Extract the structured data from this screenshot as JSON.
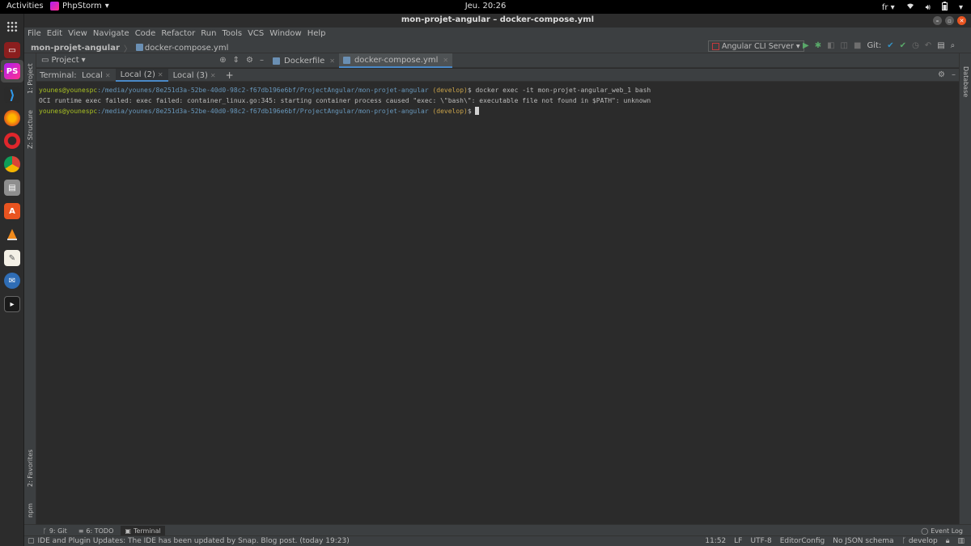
{
  "topbar": {
    "activities": "Activities",
    "app_name": "PhpStorm",
    "clock": "Jeu. 20:26",
    "lang": "fr"
  },
  "window": {
    "title": "mon-projet-angular – docker-compose.yml"
  },
  "menu": [
    "File",
    "Edit",
    "View",
    "Navigate",
    "Code",
    "Refactor",
    "Run",
    "Tools",
    "VCS",
    "Window",
    "Help"
  ],
  "navbar": {
    "project": "mon-projet-angular",
    "file": "docker-compose.yml",
    "run_config": "Angular CLI Server",
    "git_label": "Git:"
  },
  "project_panel": {
    "title": "Project"
  },
  "editor_tabs": [
    {
      "label": "Dockerfile"
    },
    {
      "label": "docker-compose.yml"
    }
  ],
  "left_strip": {
    "project": "1: Project",
    "structure": "Z: Structure",
    "favorites": "2: Favorites",
    "npm": "npm"
  },
  "right_strip": {
    "database": "Database"
  },
  "terminal": {
    "label": "Terminal:",
    "tabs": [
      "Local",
      "Local (2)",
      "Local (3)"
    ],
    "plus": "+",
    "lines": [
      {
        "user": "younes@younespc",
        "path": ":/media/younes/8e251d3a-52be-40d0-98c2-f67db196e6bf/ProjectAngular/mon-projet-angular",
        "branch": " (develop)",
        "cmd": "$ docker exec -it mon-projet-angular_web_1 bash"
      },
      {
        "text": "OCI runtime exec failed: exec failed: container_linux.go:345: starting container process caused \"exec: \\\"bash\\\": executable file not found in $PATH\": unknown"
      },
      {
        "user": "younes@younespc",
        "path": ":/media/younes/8e251d3a-52be-40d0-98c2-f67db196e6bf/ProjectAngular/mon-projet-angular",
        "branch": " (develop)",
        "cmd": "$ "
      }
    ]
  },
  "bottom_tools": {
    "git": "9: Git",
    "todo": "6: TODO",
    "terminal": "Terminal",
    "event_log": "Event Log"
  },
  "status": {
    "message": "IDE and Plugin Updates: The IDE has been updated by Snap. Blog post. (today 19:23)",
    "position": "11:52",
    "line_sep": "LF",
    "encoding": "UTF-8",
    "editorconfig": "EditorConfig",
    "schema": "No JSON schema",
    "branch": "develop"
  }
}
